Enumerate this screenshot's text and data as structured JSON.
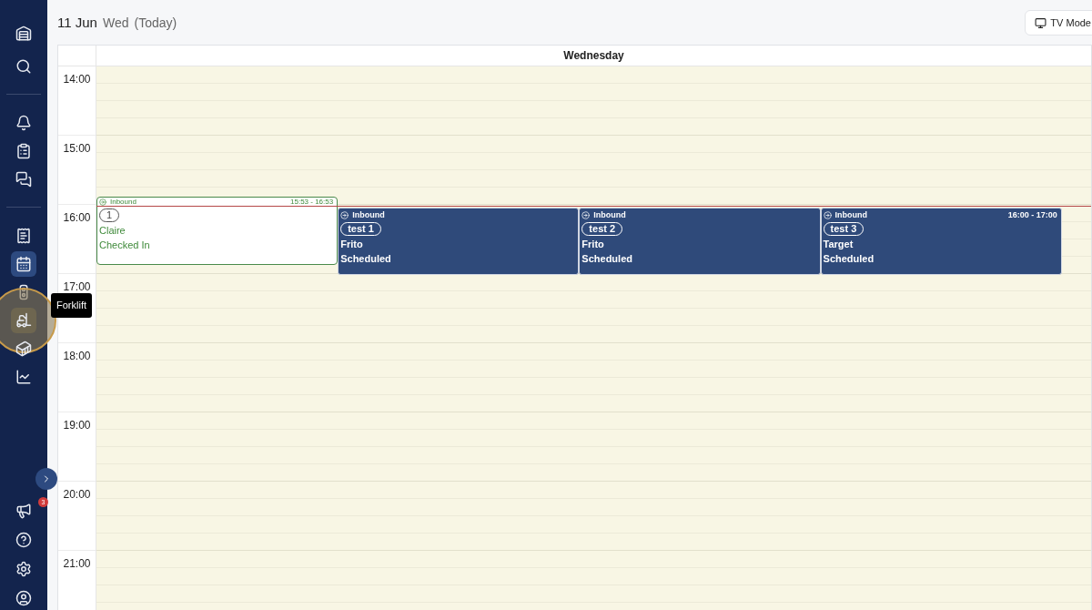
{
  "sidebar": {
    "top_items": [
      {
        "kind": "warehouse",
        "selected": false
      },
      {
        "kind": "search",
        "selected": false
      }
    ],
    "groups": [
      [
        {
          "kind": "bell",
          "selected": false
        },
        {
          "kind": "clipboard",
          "selected": false
        },
        {
          "kind": "chat",
          "selected": false
        }
      ],
      [
        {
          "kind": "list",
          "selected": false
        },
        {
          "kind": "calendar",
          "selected": true
        },
        {
          "kind": "traffic",
          "selected": false
        },
        {
          "kind": "forklift",
          "selected": false,
          "highlighted": true
        },
        {
          "kind": "container",
          "selected": false
        },
        {
          "kind": "chart",
          "selected": false
        }
      ]
    ],
    "bottom_items": [
      {
        "kind": "megaphone",
        "badge": "3"
      },
      {
        "kind": "help"
      },
      {
        "kind": "settings"
      },
      {
        "kind": "user"
      }
    ]
  },
  "tooltip": "Forklift",
  "header": {
    "date": "11 Jun",
    "weekday": "Wed",
    "note": "(Today)"
  },
  "tv_mode_button": "TV Mode",
  "calendar": {
    "day": "Wednesday",
    "hours": [
      "14:00",
      "15:00",
      "16:00",
      "17:00",
      "18:00",
      "19:00",
      "20:00",
      "21:00"
    ],
    "events": [
      {
        "kind": "checked_in",
        "type": "Inbound",
        "time": "15:53 - 16:53",
        "ref": "1",
        "carrier": "Claire",
        "status": "Checked In"
      },
      {
        "kind": "scheduled",
        "type": "Inbound",
        "ref": "test 1",
        "carrier": "Frito",
        "status": "Scheduled"
      },
      {
        "kind": "scheduled",
        "type": "Inbound",
        "ref": "test 2",
        "carrier": "Frito",
        "status": "Scheduled"
      },
      {
        "kind": "scheduled",
        "type": "Inbound",
        "time": "16:00 - 17:00",
        "ref": "test 3",
        "carrier": "Target",
        "status": "Scheduled"
      }
    ]
  }
}
